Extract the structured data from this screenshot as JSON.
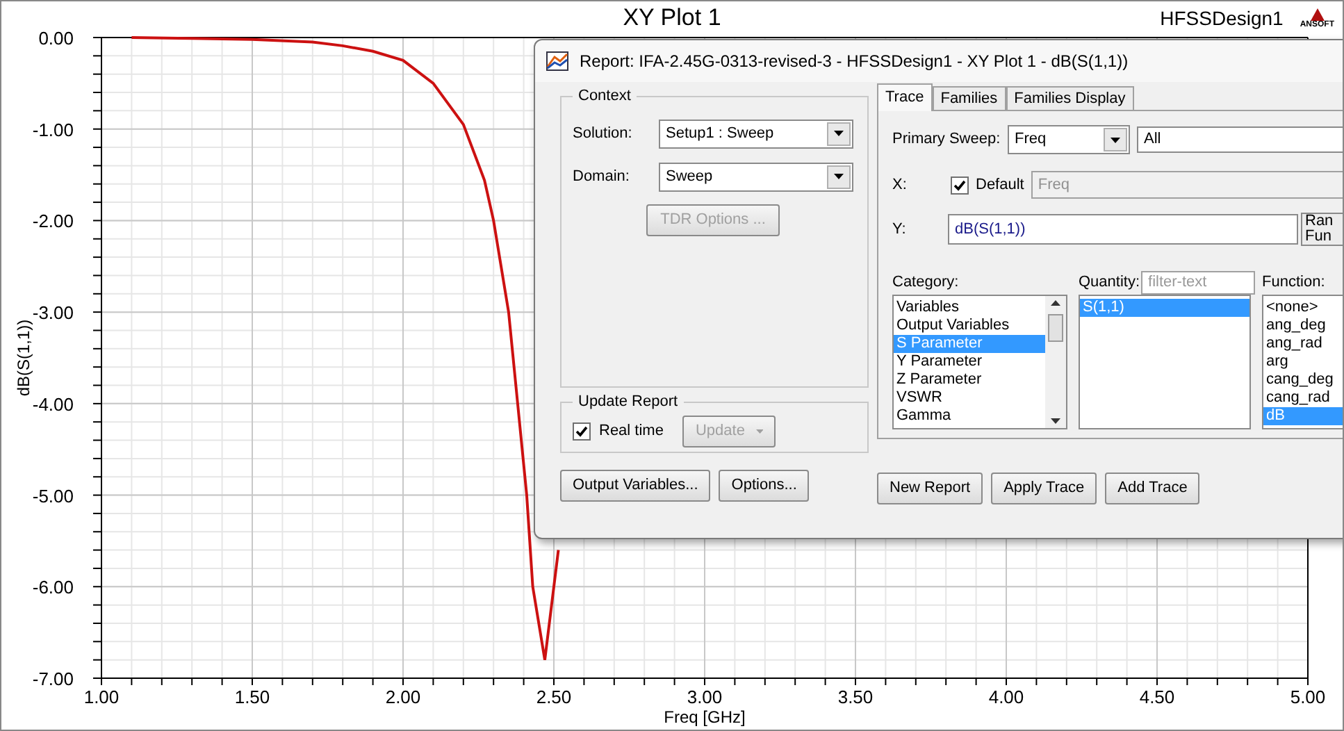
{
  "plot": {
    "title": "XY Plot 1",
    "design": "HFSSDesign1",
    "logo_text": "ANSOFT",
    "chart_data": {
      "type": "line",
      "xlabel": "Freq [GHz]",
      "ylabel": "dB(S(1,1))",
      "grid": true,
      "x": [
        1.1,
        1.3,
        1.5,
        1.7,
        1.8,
        1.9,
        2.0,
        2.1,
        2.2,
        2.27,
        2.3,
        2.35,
        2.38,
        2.41,
        2.43,
        2.47,
        2.5,
        2.515
      ],
      "series": [
        {
          "color": "#cc1111",
          "values": [
            0,
            -0.01,
            -0.02,
            -0.05,
            -0.09,
            -0.15,
            -0.25,
            -0.5,
            -0.95,
            -1.56,
            -2.0,
            -3.0,
            -4.0,
            -5.0,
            -6.0,
            -6.8,
            -6.0,
            -5.6
          ]
        }
      ],
      "xlim": [
        1,
        5
      ],
      "ylim": [
        -7,
        0
      ],
      "xticks": [
        {
          "value": 1,
          "label": "1.00"
        },
        {
          "value": 1.5,
          "label": "1.50"
        },
        {
          "value": 2,
          "label": "2.00"
        },
        {
          "value": 2.5,
          "label": "2.50"
        },
        {
          "value": 3,
          "label": "3.00"
        },
        {
          "value": 3.5,
          "label": "3.50"
        },
        {
          "value": 4,
          "label": "4.00"
        },
        {
          "value": 4.5,
          "label": "4.50"
        },
        {
          "value": 5,
          "label": "5.00"
        }
      ],
      "yticks": [
        {
          "value": 0,
          "label": "0.00"
        },
        {
          "value": -1,
          "label": "-1.00"
        },
        {
          "value": -2,
          "label": "-2.00"
        },
        {
          "value": -3,
          "label": "-3.00"
        },
        {
          "value": -4,
          "label": "-4.00"
        },
        {
          "value": -5,
          "label": "-5.00"
        },
        {
          "value": -6,
          "label": "-6.00"
        },
        {
          "value": -7,
          "label": "-7.00"
        }
      ]
    }
  },
  "dialog": {
    "title": "Report: IFA-2.45G-0313-revised-3 - HFSSDesign1 - XY Plot 1 - dB(S(1,1))",
    "context": {
      "label": "Context",
      "solution": {
        "label": "Solution:",
        "value": "Setup1 : Sweep"
      },
      "domain": {
        "label": "Domain:",
        "value": "Sweep"
      },
      "tdr_button": {
        "label": "TDR Options ...",
        "disabled": true
      }
    },
    "update_report": {
      "label": "Update Report",
      "realtime": {
        "label": "Real time",
        "checked": true
      },
      "update_button": {
        "label": "Update",
        "disabled": true
      }
    },
    "left_buttons": [
      "Output Variables...",
      "Options..."
    ],
    "tabs": [
      {
        "label": "Trace",
        "selected": true
      },
      {
        "label": "Families",
        "selected": false
      },
      {
        "label": "Families Display",
        "selected": false
      }
    ],
    "trace": {
      "primary_sweep": {
        "label": "Primary Sweep:",
        "value": "Freq",
        "range": "All"
      },
      "x": {
        "label": "X:",
        "default": {
          "label": "Default",
          "checked": true
        },
        "value": "Freq"
      },
      "y": {
        "label": "Y:",
        "value": "dB(S(1,1))"
      },
      "side_button": {
        "lines": [
          "Ran",
          "Fun"
        ]
      },
      "category": {
        "label": "Category:",
        "items": [
          {
            "label": "Variables",
            "selected": false
          },
          {
            "label": "Output Variables",
            "selected": false
          },
          {
            "label": "S Parameter",
            "selected": true
          },
          {
            "label": "Y Parameter",
            "selected": false
          },
          {
            "label": "Z Parameter",
            "selected": false
          },
          {
            "label": "VSWR",
            "selected": false
          },
          {
            "label": "Gamma",
            "selected": false
          }
        ]
      },
      "quantity": {
        "label": "Quantity:",
        "filter_placeholder": "filter-text",
        "items": [
          {
            "label": "S(1,1)",
            "selected": true
          }
        ]
      },
      "function": {
        "label": "Function:",
        "items": [
          {
            "label": "<none>",
            "selected": false
          },
          {
            "label": "ang_deg",
            "selected": false
          },
          {
            "label": "ang_rad",
            "selected": false
          },
          {
            "label": "arg",
            "selected": false
          },
          {
            "label": "cang_deg",
            "selected": false
          },
          {
            "label": "cang_rad",
            "selected": false
          },
          {
            "label": "dB",
            "selected": true
          }
        ]
      }
    },
    "bottom_buttons": [
      "New Report",
      "Apply Trace",
      "Add Trace"
    ]
  }
}
